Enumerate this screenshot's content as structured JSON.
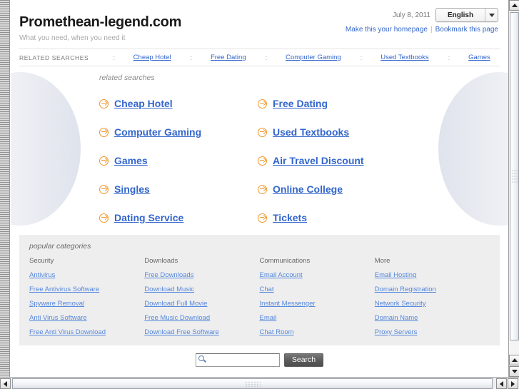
{
  "header": {
    "site_title": "Promethean-legend.com",
    "tagline": "What you need, when you need it",
    "date": "July 8, 2011",
    "language": "English",
    "homepage_link": "Make this your homepage",
    "bookmark_link": "Bookmark this page"
  },
  "related_bar": {
    "label": "RELATED SEARCHES",
    "separator": "::",
    "items": [
      {
        "label": "Cheap Hotel"
      },
      {
        "label": "Free Dating"
      },
      {
        "label": "Computer Gaming"
      },
      {
        "label": "Used Textbooks"
      },
      {
        "label": "Games"
      }
    ]
  },
  "hero": {
    "caption": "related searches",
    "columns": [
      {
        "links": [
          {
            "label": "Cheap Hotel"
          },
          {
            "label": "Computer Gaming"
          },
          {
            "label": "Games"
          },
          {
            "label": "Singles"
          },
          {
            "label": "Dating Service"
          }
        ]
      },
      {
        "links": [
          {
            "label": "Free Dating"
          },
          {
            "label": "Used Textbooks"
          },
          {
            "label": "Air Travel Discount"
          },
          {
            "label": "Online College"
          },
          {
            "label": "Tickets"
          }
        ]
      }
    ]
  },
  "categories": {
    "caption": "popular categories",
    "columns": [
      {
        "heading": "Security",
        "links": [
          {
            "label": "Antivirus"
          },
          {
            "label": "Free Antivirus Software"
          },
          {
            "label": "Spyware Removal"
          },
          {
            "label": "Anti Virus Software"
          },
          {
            "label": "Free Anti Virus Download"
          }
        ]
      },
      {
        "heading": "Downloads",
        "links": [
          {
            "label": "Free Downloads"
          },
          {
            "label": "Download Music"
          },
          {
            "label": "Download Full Movie"
          },
          {
            "label": "Free Music Download"
          },
          {
            "label": "Download Free Software"
          }
        ]
      },
      {
        "heading": "Communications",
        "links": [
          {
            "label": "Email Account"
          },
          {
            "label": "Chat"
          },
          {
            "label": "Instant Messenger"
          },
          {
            "label": "Email"
          },
          {
            "label": "Chat Room"
          }
        ]
      },
      {
        "heading": "More",
        "links": [
          {
            "label": "Email Hosting"
          },
          {
            "label": "Domain Registration"
          },
          {
            "label": "Network Security"
          },
          {
            "label": "Domain Name"
          },
          {
            "label": "Proxy Servers"
          }
        ]
      }
    ]
  },
  "search": {
    "value": "",
    "placeholder": "",
    "button_label": "Search"
  },
  "colors": {
    "link_blue": "#3366cc",
    "category_link_blue": "#5588dd",
    "arrow_orange": "#f0972a",
    "panel_gray": "#eeeeee",
    "muted_text": "#8c8c8c"
  }
}
